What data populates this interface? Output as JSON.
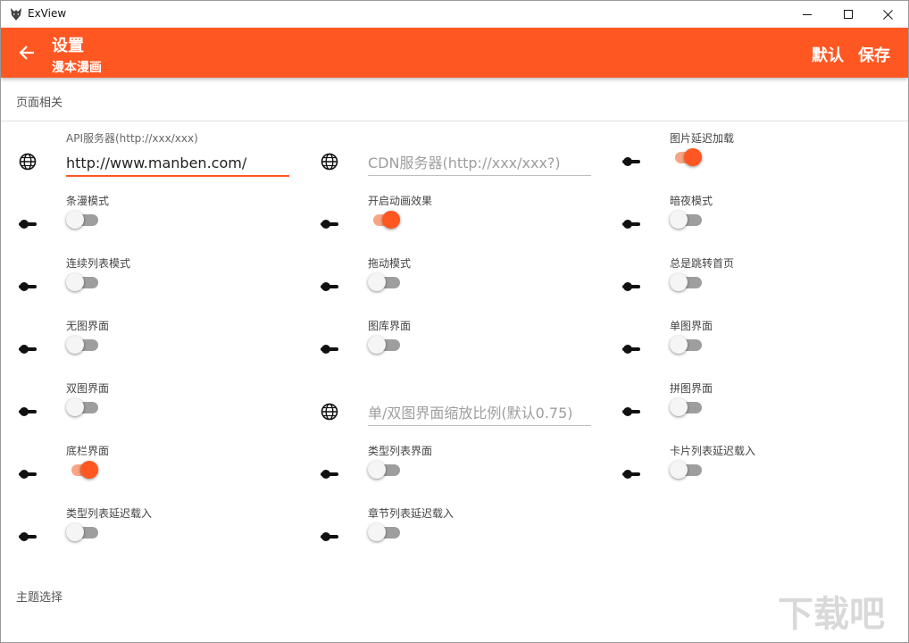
{
  "window": {
    "title": "ExView",
    "controls": {
      "minimize_icon": "minimize-icon",
      "maximize_icon": "maximize-icon",
      "close_icon": "close-icon"
    }
  },
  "appbar": {
    "title": "设置",
    "subtitle": "漫本漫画",
    "actions": {
      "default": "默认",
      "save": "保存"
    },
    "color": "#ff5722"
  },
  "sections": {
    "page": "页面相关",
    "theme": "主题选择"
  },
  "fields": {
    "api": {
      "label": "API服务器(http://xxx/xxx)",
      "value": "http://www.manben.com/",
      "placeholder": ""
    },
    "cdn": {
      "placeholder": "CDN服务器(http://xxx/xxx?)"
    },
    "scale": {
      "placeholder": "单/双图界面缩放比例(默认0.75)"
    }
  },
  "settings": [
    {
      "label": "图片延迟加载",
      "on": true
    },
    {
      "label": "条漫模式",
      "on": false
    },
    {
      "label": "开启动画效果",
      "on": true
    },
    {
      "label": "暗夜模式",
      "on": false
    },
    {
      "label": "连续列表模式",
      "on": false
    },
    {
      "label": "拖动模式",
      "on": false
    },
    {
      "label": "总是跳转首页",
      "on": false
    },
    {
      "label": "无图界面",
      "on": false
    },
    {
      "label": "图库界面",
      "on": false
    },
    {
      "label": "单图界面",
      "on": false
    },
    {
      "label": "双图界面",
      "on": false
    },
    {
      "label": "拼图界面",
      "on": false
    },
    {
      "label": "底栏界面",
      "on": true
    },
    {
      "label": "类型列表界面",
      "on": false
    },
    {
      "label": "卡片列表延迟载入",
      "on": false
    },
    {
      "label": "类型列表延迟载入",
      "on": false
    },
    {
      "label": "章节列表延迟载入",
      "on": false
    }
  ],
  "watermark": {
    "text": "下载吧"
  }
}
